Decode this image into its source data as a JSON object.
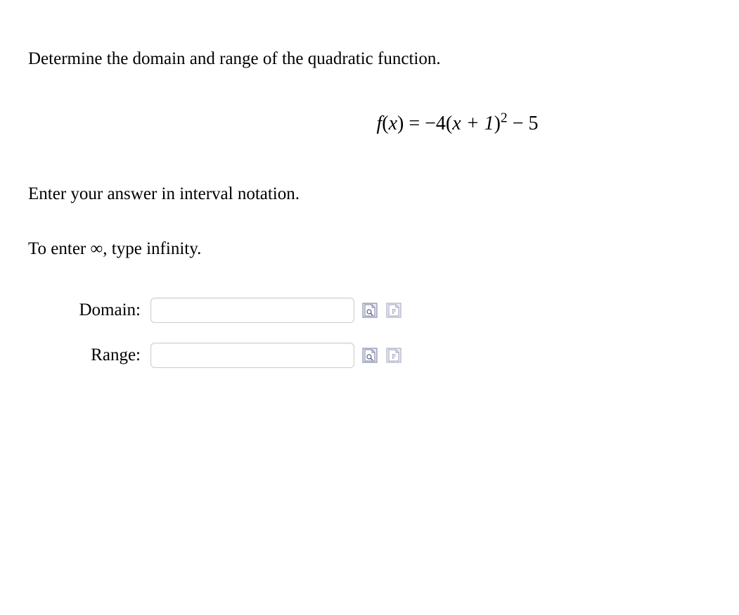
{
  "question_text": "Determine the domain and range of the quadratic function.",
  "equation": {
    "func": "f",
    "lp": "(",
    "var": "x",
    "rp": ")",
    "eq": " = ",
    "coef": "−4(",
    "inside": "x + 1",
    "rp2": ")",
    "exp": "2",
    "tail": " − 5"
  },
  "instruction": "Enter your answer in interval notation.",
  "infinity_note": "To enter ∞, type infinity.",
  "fields": {
    "domain": {
      "label": "Domain:",
      "value": ""
    },
    "range": {
      "label": "Range:",
      "value": ""
    }
  }
}
